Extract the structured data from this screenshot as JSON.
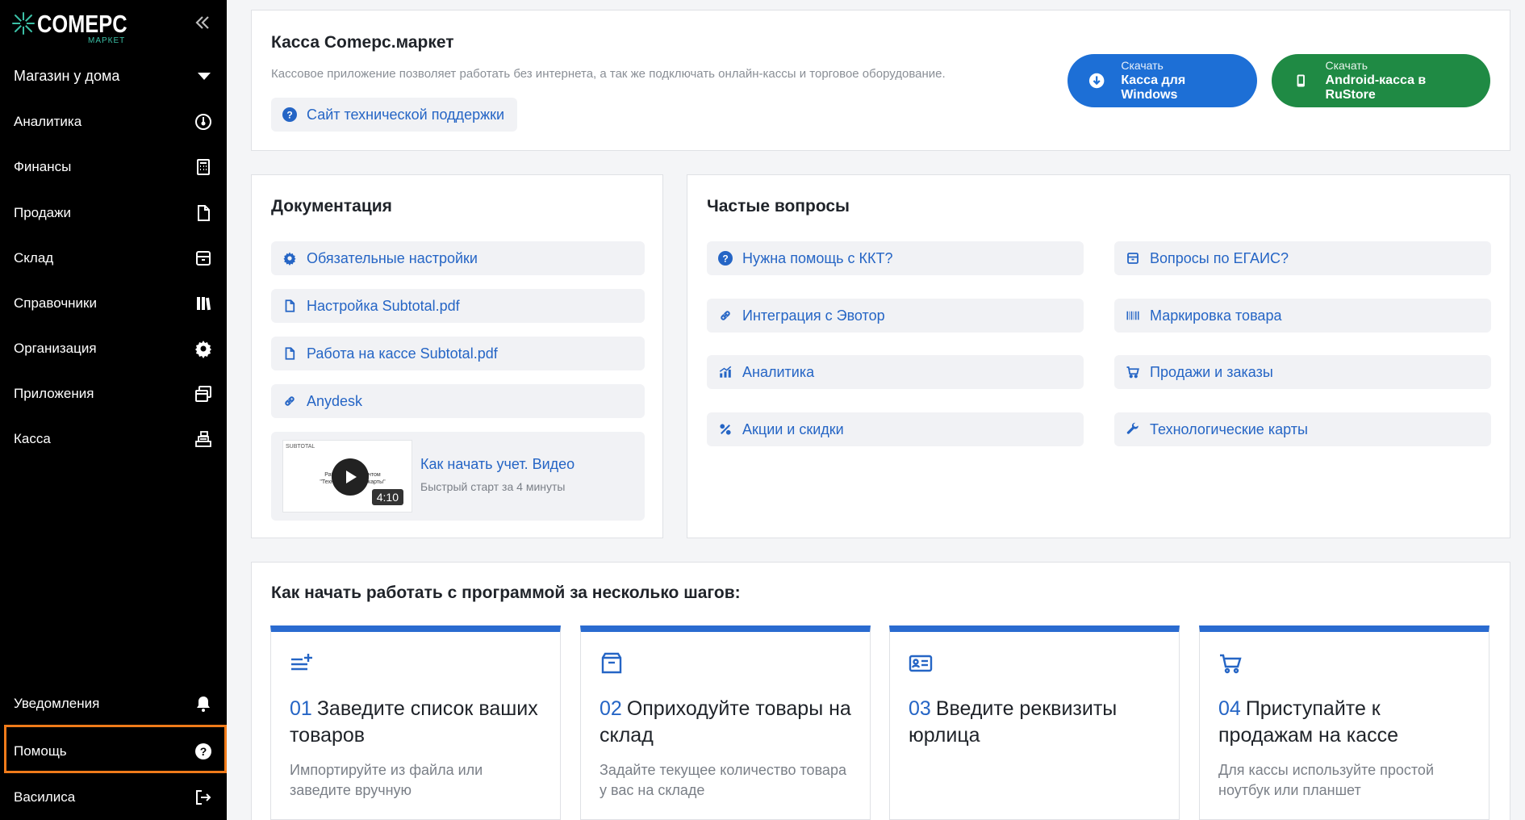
{
  "sidebar": {
    "logo_text": "COMEPC",
    "logo_sub": "МАРКЕТ",
    "store": "Магазин у дома",
    "items": [
      {
        "label": "Аналитика",
        "icon": "gauge-icon"
      },
      {
        "label": "Финансы",
        "icon": "calculator-icon"
      },
      {
        "label": "Продажи",
        "icon": "document-icon"
      },
      {
        "label": "Склад",
        "icon": "box-icon"
      },
      {
        "label": "Справочники",
        "icon": "books-icon"
      },
      {
        "label": "Организация",
        "icon": "gear-icon"
      },
      {
        "label": "Приложения",
        "icon": "windows-icon"
      },
      {
        "label": "Касса",
        "icon": "cash-register-icon"
      }
    ],
    "bottom": [
      {
        "label": "Уведомления",
        "icon": "bell-icon"
      },
      {
        "label": "Помощь",
        "icon": "question-icon"
      },
      {
        "label": "Василиса",
        "icon": "logout-icon"
      }
    ]
  },
  "kassa": {
    "title": "Касса Comepc.маркет",
    "desc": "Кассовое приложение позволяет работать без интернета, а так же подключать онлайн-кассы и торговое оборудование.",
    "support": "Сайт технической поддержки",
    "btn_windows": {
      "small": "Скачать",
      "big": "Касса для Windows"
    },
    "btn_android": {
      "small": "Скачать",
      "big": "Android-касса в RuStore"
    }
  },
  "docs": {
    "title": "Документация",
    "items": [
      "Обязательные настройки",
      "Настройка Subtotal.pdf",
      "Работа на кассе Subtotal.pdf",
      "Anydesk"
    ],
    "video_title": "Как начать учет. Видео",
    "video_sub": "Быстрый старт за 4 минуты",
    "video_duration": "4:10",
    "thumb_brand": "SUBTOTAL",
    "thumb_text": "Работа с документом \"Технологические карты\""
  },
  "faq": {
    "title": "Частые вопросы",
    "left": [
      "Нужна помощь с ККТ?",
      "Интеграция с Эвотор",
      "Аналитика",
      "Акции и скидки"
    ],
    "right": [
      "Вопросы по ЕГАИС?",
      "Маркировка товара",
      "Продажи и заказы",
      "Технологические карты"
    ]
  },
  "steps": {
    "title": "Как начать работать с программой за несколько шагов:",
    "items": [
      {
        "num": "01",
        "title": "Заведите список ваших товаров",
        "desc": "Импортируйте из файла или заведите вручную",
        "icon": "list-add-icon"
      },
      {
        "num": "02",
        "title": "Оприходуйте товары на склад",
        "desc": "Задайте текущее количество товара у вас на складе",
        "icon": "box-icon"
      },
      {
        "num": "03",
        "title": "Введите реквизиты юрлица",
        "desc": "",
        "icon": "id-card-icon"
      },
      {
        "num": "04",
        "title": "Приступайте к продажам на кассе",
        "desc": "Для кассы используйте простой ноутбук или планшет",
        "icon": "cart-icon"
      }
    ]
  },
  "colors": {
    "accent": "#2565c5",
    "windows_btn": "#1d6fd6",
    "android_btn": "#1f8a44",
    "highlight": "#f07b1a"
  }
}
